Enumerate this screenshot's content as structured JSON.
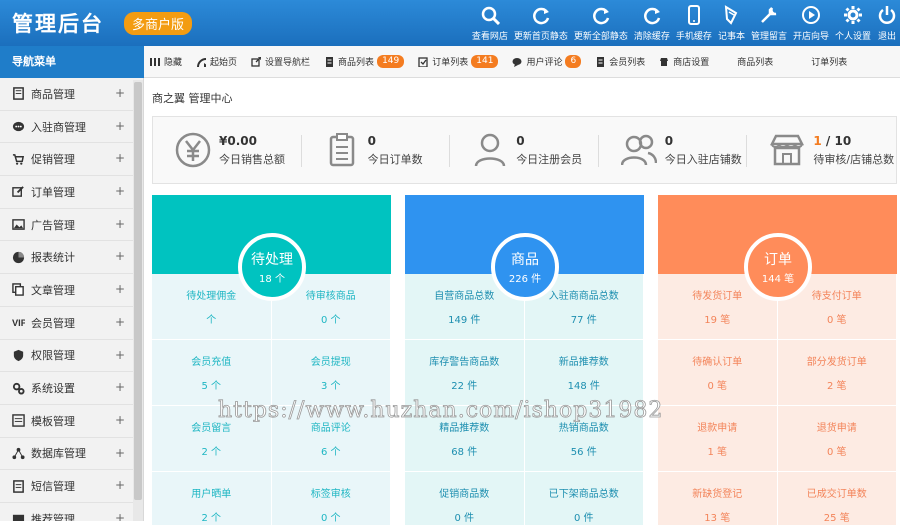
{
  "header": {
    "logo": "管理后台",
    "edition": "多商户版",
    "tools": [
      {
        "label": "查看网店",
        "icon": "search-icon"
      },
      {
        "label": "更新首页静态",
        "icon": "refresh-icon"
      },
      {
        "label": "更新全部静态",
        "icon": "refresh-icon"
      },
      {
        "label": "清除缓存",
        "icon": "refresh-icon"
      },
      {
        "label": "手机缓存",
        "icon": "mobile-icon"
      },
      {
        "label": "记事本",
        "icon": "notebook-icon"
      },
      {
        "label": "管理留言",
        "icon": "wrench-icon"
      },
      {
        "label": "开店向导",
        "icon": "play-icon"
      },
      {
        "label": "个人设置",
        "icon": "gear-icon"
      },
      {
        "label": "退出",
        "icon": "power-icon"
      }
    ]
  },
  "sidebar": {
    "title": "导航菜单",
    "items": [
      {
        "label": "商品管理",
        "icon": "book-icon"
      },
      {
        "label": "入驻商管理",
        "icon": "chat-icon"
      },
      {
        "label": "促销管理",
        "icon": "cart-icon"
      },
      {
        "label": "订单管理",
        "icon": "edit-icon"
      },
      {
        "label": "广告管理",
        "icon": "image-icon"
      },
      {
        "label": "报表统计",
        "icon": "pie-icon"
      },
      {
        "label": "文章管理",
        "icon": "copy-icon"
      },
      {
        "label": "会员管理",
        "icon": "vip-icon"
      },
      {
        "label": "权限管理",
        "icon": "shield-icon"
      },
      {
        "label": "系统设置",
        "icon": "gears-icon"
      },
      {
        "label": "模板管理",
        "icon": "template-icon"
      },
      {
        "label": "数据库管理",
        "icon": "share-icon"
      },
      {
        "label": "短信管理",
        "icon": "sms-icon"
      },
      {
        "label": "推荐管理",
        "icon": "recommend-icon"
      }
    ],
    "expand_symbol": "+"
  },
  "tabbar": {
    "tabs": [
      {
        "label": "隐藏",
        "icon": "hide-icon",
        "badge": ""
      },
      {
        "label": "起始页",
        "icon": "play-icon",
        "badge": ""
      },
      {
        "label": "设置导航栏",
        "icon": "export-icon",
        "badge": ""
      },
      {
        "label": "商品列表",
        "icon": "doc-icon",
        "badge": "149"
      },
      {
        "label": "订单列表",
        "icon": "order-icon",
        "badge": "141"
      },
      {
        "label": "用户评论",
        "icon": "comment-icon",
        "badge": "6"
      },
      {
        "label": "会员列表",
        "icon": "doc-icon",
        "badge": ""
      },
      {
        "label": "商店设置",
        "icon": "store-icon",
        "badge": ""
      },
      {
        "label": "商品列表",
        "icon": "",
        "badge": ""
      },
      {
        "label": "订单列表",
        "icon": "",
        "badge": ""
      }
    ]
  },
  "breadcrumb": "商之翼 管理中心",
  "stats": [
    {
      "value": "¥0.00",
      "label": "今日销售总额",
      "icon": "yen-icon"
    },
    {
      "value": "0",
      "label": "今日订单数",
      "icon": "clipboard-icon"
    },
    {
      "value": "0",
      "label": "今日注册会员",
      "icon": "user-icon"
    },
    {
      "value": "0",
      "label": "今日入驻店铺数",
      "icon": "users-icon"
    },
    {
      "value_hi": "1",
      "value_rest": " / 10",
      "label": "待审核/店铺总数",
      "icon": "shop-icon"
    }
  ],
  "cards": [
    {
      "title": "待处理",
      "count": "18 个",
      "color": "#00c3c0",
      "light": "#e9f6f9",
      "text": "#1eb6c3",
      "cells": [
        {
          "t": "待处理佣金",
          "v": "个"
        },
        {
          "t": "待审核商品",
          "v": "0 个"
        },
        {
          "t": "会员充值",
          "v": "5 个"
        },
        {
          "t": "会员提现",
          "v": "3 个"
        },
        {
          "t": "会员留言",
          "v": "2 个"
        },
        {
          "t": "商品评论",
          "v": "6 个"
        },
        {
          "t": "用户晒单",
          "v": "2 个"
        },
        {
          "t": "标签审核",
          "v": "0 个"
        }
      ]
    },
    {
      "title": "商品",
      "count": "226 件",
      "color": "#2f93f0",
      "light": "#e3f6f6",
      "text": "#1e8fb0",
      "cells": [
        {
          "t": "自营商品总数",
          "v": "149 件"
        },
        {
          "t": "入驻商商品总数",
          "v": "77 件"
        },
        {
          "t": "库存警告商品数",
          "v": "22 件"
        },
        {
          "t": "新品推荐数",
          "v": "148 件"
        },
        {
          "t": "精品推荐数",
          "v": "68 件"
        },
        {
          "t": "热销商品数",
          "v": "56 件"
        },
        {
          "t": "促销商品数",
          "v": "0 件"
        },
        {
          "t": "已下架商品总数",
          "v": "0 件"
        }
      ]
    },
    {
      "title": "订单",
      "count": "144 笔",
      "color": "#ff8c5a",
      "light": "#fdebe3",
      "text": "#f3845a",
      "cells": [
        {
          "t": "待发货订单",
          "v": "19 笔"
        },
        {
          "t": "待支付订单",
          "v": "0 笔"
        },
        {
          "t": "待确认订单",
          "v": "0 笔"
        },
        {
          "t": "部分发货订单",
          "v": "2 笔"
        },
        {
          "t": "退款申请",
          "v": "1 笔"
        },
        {
          "t": "退货申请",
          "v": "0 笔"
        },
        {
          "t": "新缺货登记",
          "v": "13 笔"
        },
        {
          "t": "已成交订单数",
          "v": "25 笔"
        }
      ]
    }
  ],
  "watermark": "https://www.huzhan.com/ishop31982"
}
